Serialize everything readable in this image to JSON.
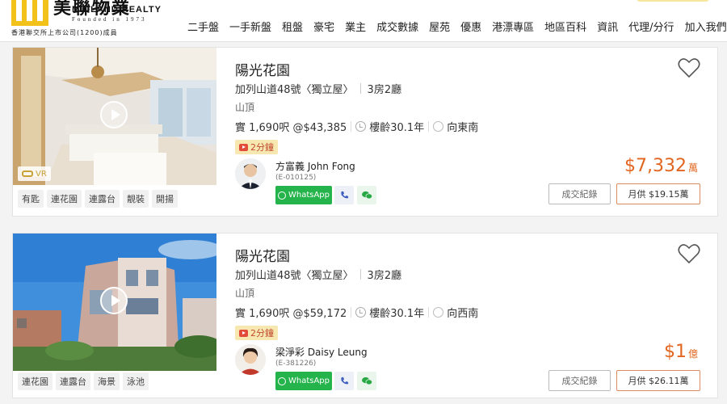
{
  "brand": {
    "name_cn": "美聯物業",
    "name_en": "MIDLAND REALTY",
    "founded": "Founded in 1973",
    "listed": "香港聯交所上市公司(1200)成員",
    "yellow": "#f2c21b"
  },
  "nav": [
    "二手盤",
    "一手新盤",
    "租盤",
    "豪宅",
    "業主",
    "成交數據",
    "屋苑",
    "優惠",
    "港漂專區",
    "地區百科",
    "資訊",
    "代理/分行",
    "加入我們"
  ],
  "listings": [
    {
      "title": "陽光花園",
      "address": "加列山道48號〈獨立屋〉",
      "rooms": "3房2廳",
      "district": "山頂",
      "area": "實 1,690呎 @$43,385",
      "age": "樓齡30.1年",
      "facing": "向東南",
      "video_badge": "2分鐘",
      "vr_label": "VR",
      "tags": [
        "有匙",
        "連花園",
        "連露台",
        "靚裝",
        "開揚"
      ],
      "agent_name": "方富義 John Fong",
      "agent_license": "(E-010125)",
      "whatsapp_label": "WhatsApp",
      "price": "$7,332",
      "price_unit": "萬",
      "history_label": "成交紀錄",
      "monthly_label": "月供 $19.15萬"
    },
    {
      "title": "陽光花園",
      "address": "加列山道48號〈獨立屋〉",
      "rooms": "3房2廳",
      "district": "山頂",
      "area": "實 1,690呎 @$59,172",
      "age": "樓齡30.1年",
      "facing": "向西南",
      "video_badge": "2分鐘",
      "tags": [
        "連花園",
        "連露台",
        "海景",
        "泳池"
      ],
      "agent_name": "梁淨彩 Daisy Leung",
      "agent_license": "(E-381226)",
      "whatsapp_label": "WhatsApp",
      "price": "$1",
      "price_unit": "億",
      "history_label": "成交紀錄",
      "monthly_label": "月供 $26.11萬"
    }
  ],
  "colors": {
    "price": "#e2661f",
    "whatsapp": "#25b34b"
  }
}
